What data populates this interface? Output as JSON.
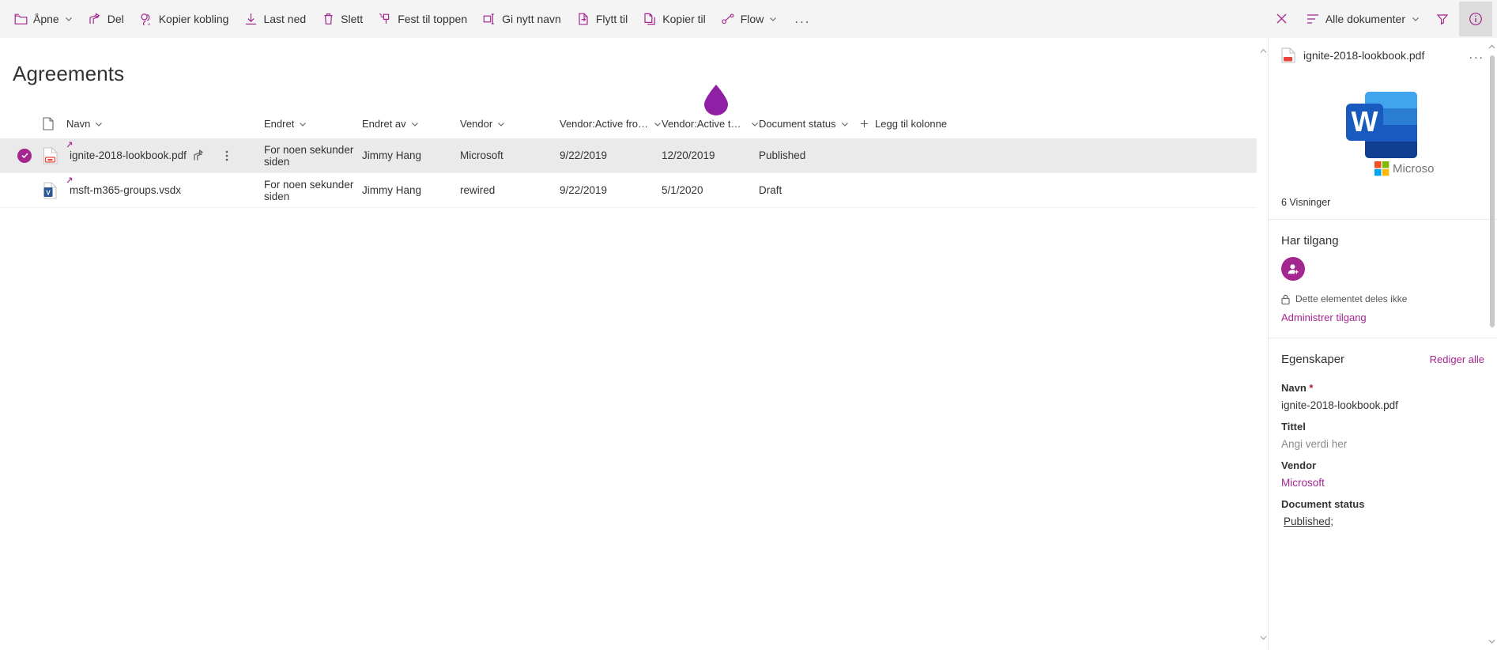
{
  "commandbar": {
    "items": [
      {
        "label": "Åpne",
        "icon": "open-icon",
        "caret": true
      },
      {
        "label": "Del",
        "icon": "share-icon",
        "caret": false
      },
      {
        "label": "Kopier kobling",
        "icon": "link-icon",
        "caret": false
      },
      {
        "label": "Last ned",
        "icon": "download-icon",
        "caret": false
      },
      {
        "label": "Slett",
        "icon": "trash-icon",
        "caret": false
      },
      {
        "label": "Fest til toppen",
        "icon": "pin-icon",
        "caret": false
      },
      {
        "label": "Gi nytt navn",
        "icon": "rename-icon",
        "caret": false
      },
      {
        "label": "Flytt til",
        "icon": "move-icon",
        "caret": false
      },
      {
        "label": "Kopier til",
        "icon": "copy-icon",
        "caret": false
      },
      {
        "label": "Flow",
        "icon": "flow-icon",
        "caret": true
      }
    ],
    "overflow_label": "...",
    "close_label": "close-icon",
    "view_label": "Alle dokumenter",
    "filter_label": "filter-icon",
    "info_label": "info-icon"
  },
  "page": {
    "title": "Agreements"
  },
  "table": {
    "columns": [
      {
        "key": "name",
        "label": "Navn"
      },
      {
        "key": "mod",
        "label": "Endret"
      },
      {
        "key": "modby",
        "label": "Endret av"
      },
      {
        "key": "vendor",
        "label": "Vendor"
      },
      {
        "key": "from",
        "label": "Vendor:Active from..."
      },
      {
        "key": "to",
        "label": "Vendor:Active to D..."
      },
      {
        "key": "status",
        "label": "Document status"
      }
    ],
    "add_column_label": "Legg til kolonne",
    "rows": [
      {
        "name": "ignite-2018-lookbook.pdf",
        "filetype": "pdf",
        "modified": "For noen sekunder siden",
        "modified_by": "Jimmy Hang",
        "vendor": "Microsoft",
        "active_from": "9/22/2019",
        "active_to": "12/20/2019",
        "status": "Published",
        "selected": true,
        "is_new": true
      },
      {
        "name": "msft-m365-groups.vsdx",
        "filetype": "vsdx",
        "modified": "For noen sekunder siden",
        "modified_by": "Jimmy Hang",
        "vendor": "rewired",
        "active_from": "9/22/2019",
        "active_to": "5/1/2020",
        "status": "Draft",
        "selected": false,
        "is_new": true
      }
    ]
  },
  "details": {
    "title": "ignite-2018-lookbook.pdf",
    "more_label": "...",
    "preview_brand": "Microsoft",
    "preview_letter": "W",
    "views": "6 Visninger",
    "access": {
      "heading": "Har tilgang",
      "not_shared": "Dette elementet deles ikke",
      "manage_link": "Administrer tilgang"
    },
    "properties": {
      "heading": "Egenskaper",
      "edit_all": "Rediger alle",
      "fields": [
        {
          "label": "Navn",
          "required": true,
          "value": "ignite-2018-lookbook.pdf",
          "style": "normal"
        },
        {
          "label": "Tittel",
          "required": false,
          "value": "Angi verdi her",
          "style": "placeholder"
        },
        {
          "label": "Vendor",
          "required": false,
          "value": "Microsoft",
          "style": "link"
        },
        {
          "label": "Document status",
          "required": false,
          "value": "Published;",
          "style": "underline"
        }
      ]
    }
  },
  "colors": {
    "accent": "#a4268f",
    "cmdbar_bg": "#f4f4f4",
    "selected_row": "#eaeaea"
  }
}
